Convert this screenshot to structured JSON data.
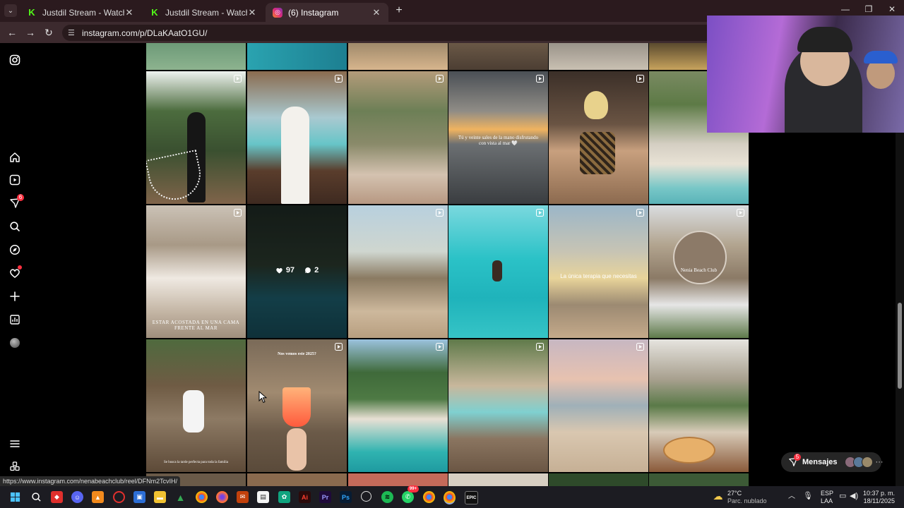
{
  "browser": {
    "tabs": [
      {
        "title": "Justdil Stream - Watch Live on Kic",
        "icon": "kick-icon",
        "active": false
      },
      {
        "title": "Justdil Stream - Watch Live on Kic",
        "icon": "kick-icon",
        "active": false
      },
      {
        "title": "(6) Instagram",
        "icon": "instagram-icon",
        "active": true
      }
    ],
    "url": "instagram.com/p/DLaKAatO1GU/",
    "window_controls": [
      "—",
      "❐",
      "✕"
    ]
  },
  "instagram": {
    "nav": {
      "notifications_badge": "6",
      "items": [
        "instagram-logo",
        "home",
        "reels",
        "messages",
        "search",
        "explore",
        "notifications",
        "create",
        "dashboard",
        "profile",
        "more",
        "threads"
      ]
    },
    "tiles": {
      "ninety_seven_likes": "97",
      "two_comments": "2",
      "caption_sunset_a": "Tú y veinte sales de la mano disfrutando con vista al mar 🤍",
      "caption_hammock": "ESTAR ACOSTADA EN UNA CAMA FRENTE AL MAR",
      "caption_terapia": "La única terapia que necesitas",
      "caption_nenia": "Nenia Beach Club",
      "caption_cocktail": "Nos vemos este 2025?",
      "caption_child": "Se busca la tarde perfecta para toda la familia"
    },
    "messages_button": {
      "label": "Mensajes",
      "badge": "5"
    },
    "status_url": "https://www.instagram.com/nenabeachclub/reel/DFNm2TcvIH/"
  },
  "taskbar": {
    "weather_temp": "27°C",
    "weather_desc": "Parc. nublado",
    "lang_top": "ESP",
    "lang_bottom": "LAA",
    "time": "10:37 p. m.",
    "date": "18/11/2025",
    "whatsapp_badge": "99+"
  },
  "colors": {
    "tab_bar": "#2b1a1e",
    "toolbar": "#3c2a2e",
    "accent_red": "#ff3040",
    "kick_green": "#53fc18"
  }
}
